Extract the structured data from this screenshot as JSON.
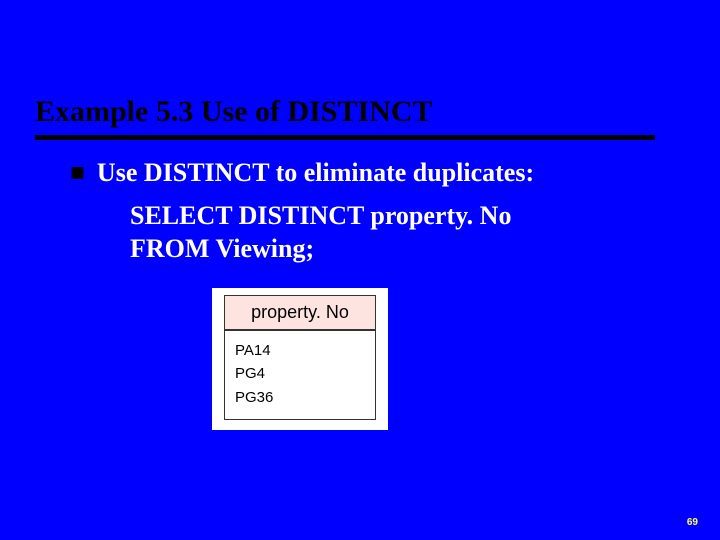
{
  "title": "Example 5.3  Use of DISTINCT",
  "bullet": {
    "text": "Use DISTINCT to eliminate duplicates:"
  },
  "sql": {
    "line1": "SELECT DISTINCT property. No",
    "line2": "FROM Viewing;"
  },
  "result": {
    "header": "property. No",
    "rows": [
      "PA14",
      "PG4",
      "PG36"
    ]
  },
  "page_number": "69",
  "chart_data": {
    "type": "table",
    "title": "property. No",
    "columns": [
      "property. No"
    ],
    "rows": [
      [
        "PA14"
      ],
      [
        "PG4"
      ],
      [
        "PG36"
      ]
    ]
  }
}
